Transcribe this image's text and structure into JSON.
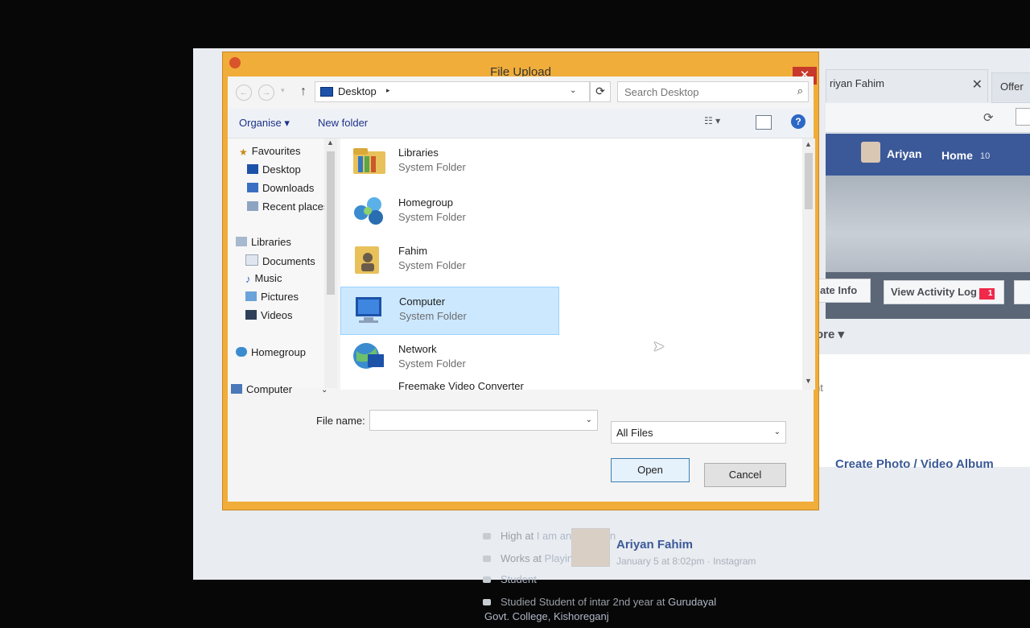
{
  "browser": {
    "tab_title": "riyan Fahim",
    "tab_close": "✕",
    "tab2_title": "Offer",
    "reload_glyph": "⟳"
  },
  "facebook": {
    "user_name": "Ariyan",
    "home_label": "Home",
    "home_count": "10",
    "update_info": "ate Info",
    "activity_log": "View Activity Log",
    "activity_badge": "1",
    "more_label": "ore",
    "more_arrow": "▾",
    "side_text": "nt",
    "create_album": "Create Photo / Video Album",
    "info_lines": [
      {
        "pre": "High at ",
        "link": "I am an Assassin"
      },
      {
        "pre": "Works at ",
        "link": "Playing Game"
      },
      {
        "pre": "",
        "link": "Student"
      },
      {
        "pre": "Studied Student of intar 2nd year at ",
        "link": "Gurudayal"
      }
    ],
    "info_line5": "Govt. College, Kishoreganj",
    "post_author": "Ariyan Fahim",
    "post_meta": "January 5 at 8:02pm · Instagram"
  },
  "dialog": {
    "title": "File Upload",
    "close_glyph": "✕",
    "toolbar": {
      "back_glyph": "←",
      "forward_glyph": "→",
      "up_glyph": "↑",
      "location": "Desktop",
      "crumb_arrow": "▸",
      "dropdown_glyph": "⌄",
      "refresh_glyph": "⟳",
      "search_placeholder": "Search Desktop",
      "search_glyph": "⌕"
    },
    "commands": {
      "organise": "Organise ▾",
      "new_folder": "New folder",
      "view_glyph": "☷ ▾",
      "help_glyph": "?"
    },
    "nav": {
      "favourites": "Favourites",
      "desktop": "Desktop",
      "downloads": "Downloads",
      "recent": "Recent places",
      "libraries": "Libraries",
      "documents": "Documents",
      "music": "Music",
      "pictures": "Pictures",
      "videos": "Videos",
      "homegroup": "Homegroup",
      "computer": "Computer",
      "computer_arrow": "⌄",
      "scroll_up": "▲",
      "scroll_down": "▼"
    },
    "files": [
      {
        "name": "Libraries",
        "type": "System Folder"
      },
      {
        "name": "Homegroup",
        "type": "System Folder"
      },
      {
        "name": "Fahim",
        "type": "System Folder"
      },
      {
        "name": "Computer",
        "type": "System Folder"
      },
      {
        "name": "Network",
        "type": "System Folder"
      },
      {
        "name": "Freemake Video Converter",
        "type": ""
      }
    ],
    "file_name_label": "File name:",
    "file_name_value": "",
    "file_name_dropdown": "⌄",
    "file_type": "All Files",
    "file_type_dropdown": "⌄",
    "open_label": "Open",
    "cancel_label": "Cancel",
    "cursor_glyph": "➤"
  },
  "colors": {
    "title_bar": "#f0ad3a",
    "close_button": "#c7392b",
    "facebook_blue": "#3b5998",
    "selection": "#cce8ff"
  }
}
